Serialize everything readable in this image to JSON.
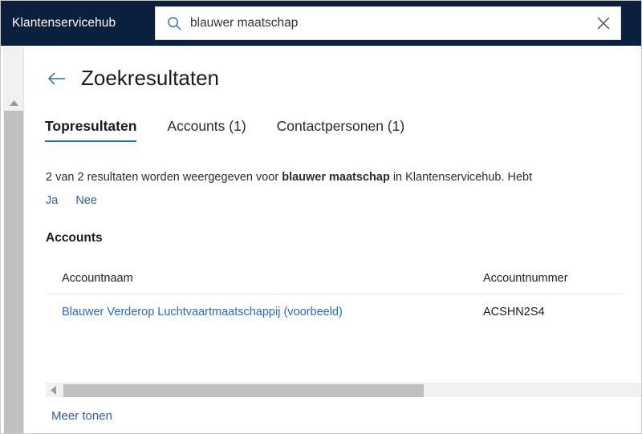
{
  "topbar": {
    "app_title": "Klantenservicehub",
    "search": {
      "value": "blauwer maatschap",
      "placeholder": "Zoeken",
      "icon": "search-icon",
      "clear_icon": "close-icon"
    },
    "background_color": "#0b1f3f"
  },
  "page": {
    "back_icon": "arrow-left-icon",
    "title": "Zoekresultaten"
  },
  "tabs": [
    {
      "label": "Topresultaten",
      "active": true
    },
    {
      "label": "Accounts (1)",
      "active": false
    },
    {
      "label": "Contactpersonen (1)",
      "active": false
    }
  ],
  "summary": {
    "prefix": "2 van 2 resultaten worden weergegeven voor ",
    "term": "blauwer maatschap",
    "suffix": " in Klantenservicehub. Hebt"
  },
  "feedback": {
    "yes_label": "Ja",
    "no_label": "Nee"
  },
  "accounts": {
    "section_title": "Accounts",
    "columns": [
      "Accountnaam",
      "Accountnummer"
    ],
    "rows": [
      {
        "account_name": "Blauwer Verderop Luchtvaartmaatschappij (voorbeeld)",
        "account_number": "ACSHN2S4"
      }
    ],
    "more_label": "Meer tonen"
  },
  "scrollbars": {
    "vertical_up_icon": "triangle-up-icon",
    "horizontal_left_icon": "triangle-left-icon"
  },
  "colors": {
    "header_bg": "#0b1f3f",
    "link": "#2b6cb5",
    "accent_underline": "#2b6cb5",
    "scrollbar_thumb": "#c0c0c0"
  }
}
